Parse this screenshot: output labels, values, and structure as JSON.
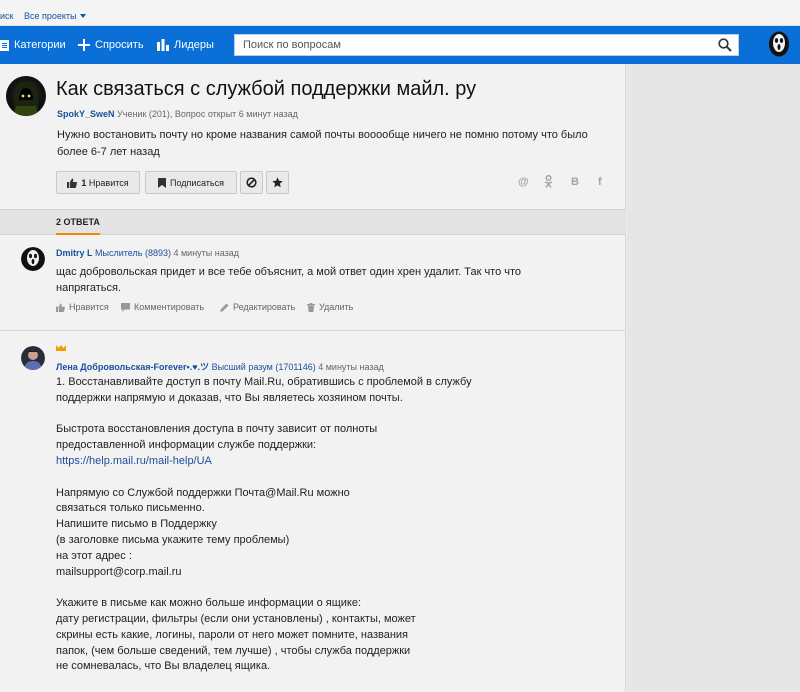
{
  "topstrip": {
    "left_text": "иск",
    "projects": "Все проекты"
  },
  "nav": {
    "categories": "Категории",
    "ask": "Спросить",
    "leaders": "Лидеры",
    "search_placeholder": "Поиск по вопросам"
  },
  "question": {
    "title": "Как связаться с службой поддержки майл. ру",
    "author": "SpokY_SweN",
    "author_rank": "Ученик (201),",
    "status": "Вопрос открыт 6 минут назад",
    "text": "Нужно востановить почту но кроме названия самой почты вооообще ничего не помню потому что было более 6-7 лет назад",
    "like_count": "1",
    "like_label": "Нравится",
    "subscribe_label": "Подписаться",
    "share_icons": [
      "@",
      "ok",
      "B",
      "f"
    ]
  },
  "answers_tab": "2 ОТВЕТА",
  "answers": [
    {
      "author": "Dmitry L",
      "rank": "Мыслитель (8893)",
      "time": "4 минуты назад",
      "text": "щас добровольская придет и все тебе объяснит, а мой ответ один хрен удалит. Так что что напрягаться.",
      "actions": [
        "Нравится",
        "Комментировать",
        "Редактировать",
        "Удалить"
      ]
    },
    {
      "author": "Лена Добровольская-Forever•.♥.ツ",
      "rank": "Высший разум (1701146)",
      "time": "4 минуты назад",
      "text_before_link": "1. Восстанавливайте доступ в почту Mail.Ru, обратившись с проблемой в службу\nподдержки напрямую и доказав, что Вы являетесь хозяином почты.\n\nБыстрота восстановления доступа в почту зависит от полноты\nпредоставленной информации службе поддержки:\n",
      "link": "https://help.mail.ru/mail-help/UA",
      "text_after_link": "\n\nНапрямую со Службой поддержки Почта@Mail.Ru можно\nсвязаться только письменно.\nНапишите письмо в Поддержку\n(в заголовке письма укажите тему проблемы)\nна этот адрес :\nmailsupport@corp.mail.ru\n\nУкажите в письме как можно больше информации о ящике:\nдату регистрации, фильтры (если они установлены) , контакты, может\nскрины есть какие, логины, пароли от него может помните, названия\nпапок, (чем больше сведений, тем лучше) , чтобы служба поддержки\nне сомневалась, что Вы владелец ящика."
    }
  ],
  "colors": {
    "nav": "#0a6fd6",
    "link": "#1a4f9c",
    "accent": "#f08a00"
  }
}
